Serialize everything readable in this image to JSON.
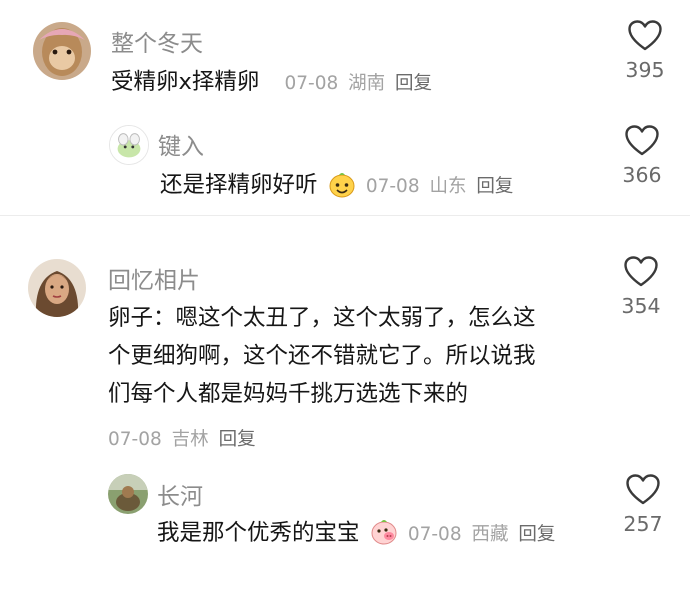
{
  "comments": [
    {
      "user": "整个冬天",
      "text": "受精卵x择精卵",
      "date": "07-08",
      "location": "湖南",
      "reply_label": "回复",
      "likes": "395",
      "replies": [
        {
          "user": "键入",
          "text": "还是择精卵好听",
          "emoji": "smiling-face-emoji",
          "date": "07-08",
          "location": "山东",
          "reply_label": "回复",
          "likes": "366"
        }
      ]
    },
    {
      "user": "回忆相片",
      "text_lines": [
        "卵子：嗯这个太丑了，这个太弱了，怎么这",
        "个更细狗啊，这个还不错就它了。所以说我",
        "们每个人都是妈妈千挑万选选下来的"
      ],
      "date": "07-08",
      "location": "吉林",
      "reply_label": "回复",
      "likes": "354",
      "replies": [
        {
          "user": "长河",
          "text": "我是那个优秀的宝宝",
          "emoji": "pig-face-emoji",
          "date": "07-08",
          "location": "西藏",
          "reply_label": "回复",
          "likes": "257"
        }
      ]
    }
  ],
  "colors": {
    "username": "#8c8c8c",
    "text": "#161616",
    "meta": "#a3a3a3",
    "reply": "#6b6b6b",
    "like_icon": "#3a3a3a"
  }
}
